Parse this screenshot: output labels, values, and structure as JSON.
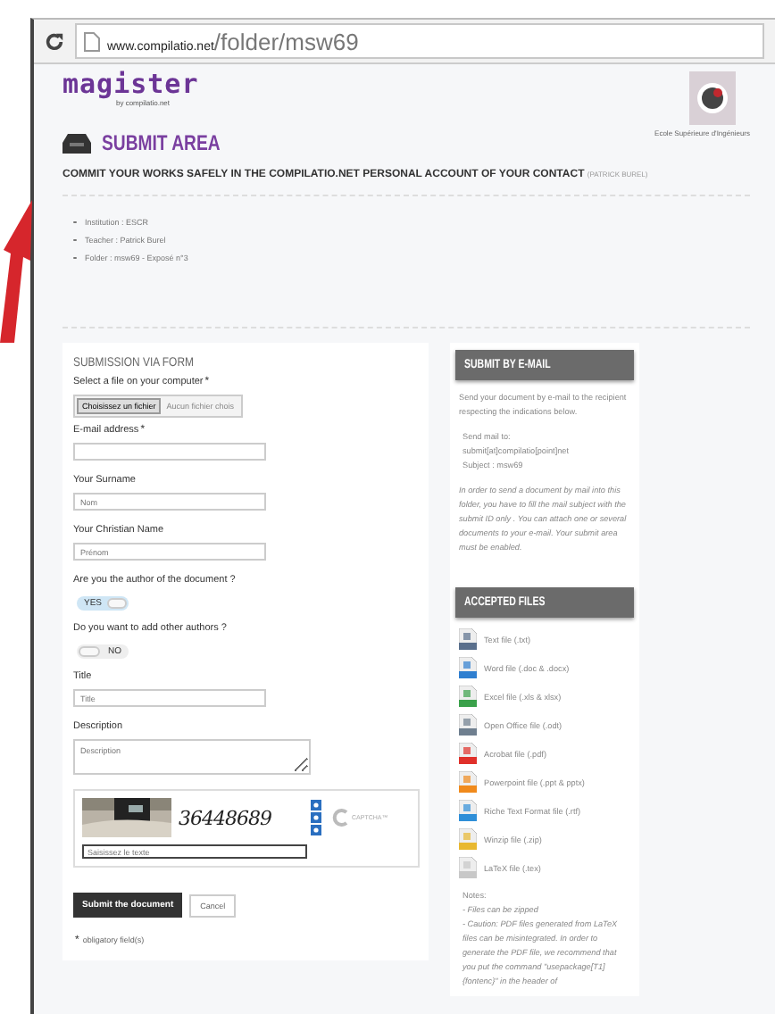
{
  "browser": {
    "url_host": "www.compilatio.net",
    "url_path": "/folder/msw69"
  },
  "header": {
    "logo": "magister",
    "logo_byline": "by compilatio.net",
    "school_caption": "Ecole Supérieure d'Ingénieurs"
  },
  "title": "SUBMIT AREA",
  "subtitle": "COMMIT YOUR WORKS SAFELY IN THE COMPILATIO.NET PERSONAL ACCOUNT OF YOUR CONTACT",
  "subtitle_contact": "(PATRICK BUREL)",
  "details": [
    "Institution : ESCR",
    "Teacher : Patrick Burel",
    "Folder : msw69 - Exposé n°3"
  ],
  "form": {
    "heading": "SUBMISSION VIA FORM",
    "fields": [
      {
        "kind": "file",
        "label": "Select a file on your computer",
        "required_mark": "*",
        "button": "Choisissez un fichier",
        "status": "Aucun fichier chois"
      },
      {
        "kind": "text",
        "label": "E-mail address",
        "required_mark": "*"
      },
      {
        "kind": "text",
        "label": "Your Surname",
        "placeholder": "Nom"
      },
      {
        "kind": "text",
        "label": "Your Christian Name",
        "placeholder": "Prénom"
      },
      {
        "kind": "toggle",
        "label": "Are you the author of the document ?",
        "on": true,
        "value": "YES"
      },
      {
        "kind": "toggle",
        "label": "Do you want to add other authors ?",
        "on": false,
        "value": "NO"
      },
      {
        "kind": "text",
        "label": "Title",
        "placeholder": "Title"
      },
      {
        "kind": "textarea",
        "label": "Description",
        "placeholder": "Description"
      }
    ],
    "captcha": {
      "code": "36448689",
      "brand": "CAPTCHA™",
      "placeholder": "Saisissez le texte"
    },
    "submit": "Submit the document",
    "cancel": "Cancel",
    "required_note_mark": "*",
    "required_note": "obligatory field(s)"
  },
  "email": {
    "heading": "SUBMIT BY E-MAIL",
    "intro": "Send your document by e-mail to the recipient respecting the indications below.",
    "send_to_label": "Send mail to:",
    "address": "submit[at]compilatio[point]net",
    "subject": "Subject : msw69",
    "instructions": "In order to send a document by mail into this folder, you have to fill the mail subject with the submit ID only . You can attach one or several documents to your e-mail. Your submit area must be enabled."
  },
  "accepted": {
    "heading": "ACCEPTED FILES",
    "files": [
      {
        "label": "Text file (.txt)",
        "color": "#5a6f8c"
      },
      {
        "label": "Word file (.doc & .docx)",
        "color": "#2f7fd0"
      },
      {
        "label": "Excel file (.xls & xlsx)",
        "color": "#3aa14a"
      },
      {
        "label": "Open Office file (.odt)",
        "color": "#6f7f8f"
      },
      {
        "label": "Acrobat file (.pdf)",
        "color": "#e0302a"
      },
      {
        "label": "Powerpoint file (.ppt & pptx)",
        "color": "#f08a1c"
      },
      {
        "label": "Riche Text Format file (.rtf)",
        "color": "#2f8fd8"
      },
      {
        "label": "Winzip file (.zip)",
        "color": "#e8b830"
      },
      {
        "label": "LaTeX file (.tex)",
        "color": "#c8c8c8"
      }
    ],
    "notes_heading": "Notes:",
    "notes": [
      "- Files can be zipped",
      "- Caution: PDF files generated from LaTeX files can be misintegrated. In order to generate the PDF file, we recommend that you put the command \"usepackage[T1]{fontenc}\" in the header of"
    ]
  }
}
